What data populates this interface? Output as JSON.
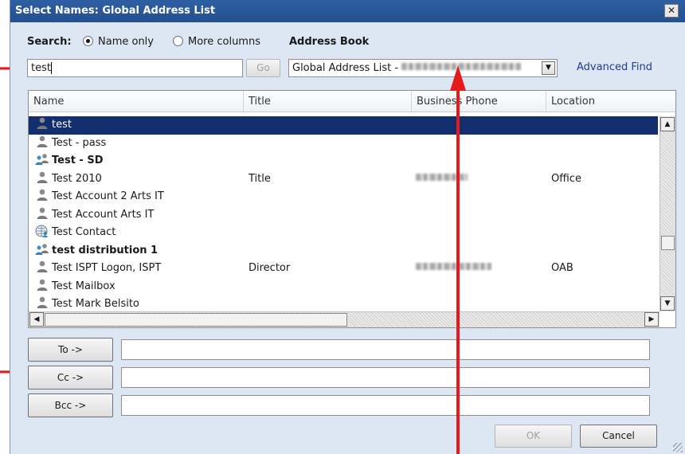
{
  "dialog": {
    "title": "Select Names: Global Address List",
    "close_glyph": "✕"
  },
  "search": {
    "label": "Search:",
    "option_name_only": "Name only",
    "option_more_columns": "More columns",
    "selected": "Name only",
    "value": "test",
    "go_label": "Go"
  },
  "address_book": {
    "label": "Address Book",
    "selected": "Global Address List - ",
    "advanced_find": "Advanced Find"
  },
  "list": {
    "columns": [
      "Name",
      "Title",
      "Business Phone",
      "Location"
    ],
    "rows": [
      {
        "name": "test",
        "title": "",
        "phone_redacted": false,
        "location": "",
        "icon": "user-icon",
        "bold": false,
        "selected": true
      },
      {
        "name": "Test - pass",
        "title": "",
        "phone_redacted": false,
        "location": "",
        "icon": "user-icon",
        "bold": false,
        "selected": false
      },
      {
        "name": "Test - SD",
        "title": "",
        "phone_redacted": false,
        "location": "",
        "icon": "group-icon",
        "bold": true,
        "selected": false
      },
      {
        "name": "Test 2010",
        "title": "Title",
        "phone_redacted": true,
        "location": "Office",
        "icon": "user-icon",
        "bold": false,
        "selected": false
      },
      {
        "name": "Test Account 2 Arts IT",
        "title": "",
        "phone_redacted": false,
        "location": "",
        "icon": "user-icon",
        "bold": false,
        "selected": false
      },
      {
        "name": "Test Account Arts IT",
        "title": "",
        "phone_redacted": false,
        "location": "",
        "icon": "user-icon",
        "bold": false,
        "selected": false
      },
      {
        "name": "Test Contact",
        "title": "",
        "phone_redacted": false,
        "location": "",
        "icon": "contact-globe-icon",
        "bold": false,
        "selected": false
      },
      {
        "name": "test distribution 1",
        "title": "",
        "phone_redacted": false,
        "location": "",
        "icon": "group-icon",
        "bold": true,
        "selected": false
      },
      {
        "name": "Test ISPT Logon, ISPT",
        "title": "Director",
        "phone_redacted": true,
        "location": "OAB",
        "icon": "user-icon",
        "bold": false,
        "selected": false
      },
      {
        "name": "Test Mailbox",
        "title": "",
        "phone_redacted": false,
        "location": "",
        "icon": "user-icon",
        "bold": false,
        "selected": false
      },
      {
        "name": "Test Mark Belsito",
        "title": "",
        "phone_redacted": false,
        "location": "",
        "icon": "user-icon",
        "bold": false,
        "selected": false
      }
    ]
  },
  "recipients": {
    "to_label": "To ->",
    "cc_label": "Cc ->",
    "bcc_label": "Bcc ->",
    "to_value": "",
    "cc_value": "",
    "bcc_value": ""
  },
  "footer": {
    "ok_label": "OK",
    "cancel_label": "Cancel"
  },
  "colors": {
    "title_bar": "#2f5fa3",
    "selection": "#122e6d",
    "annotation": "#e31b1b",
    "link": "#1f3c8f"
  }
}
